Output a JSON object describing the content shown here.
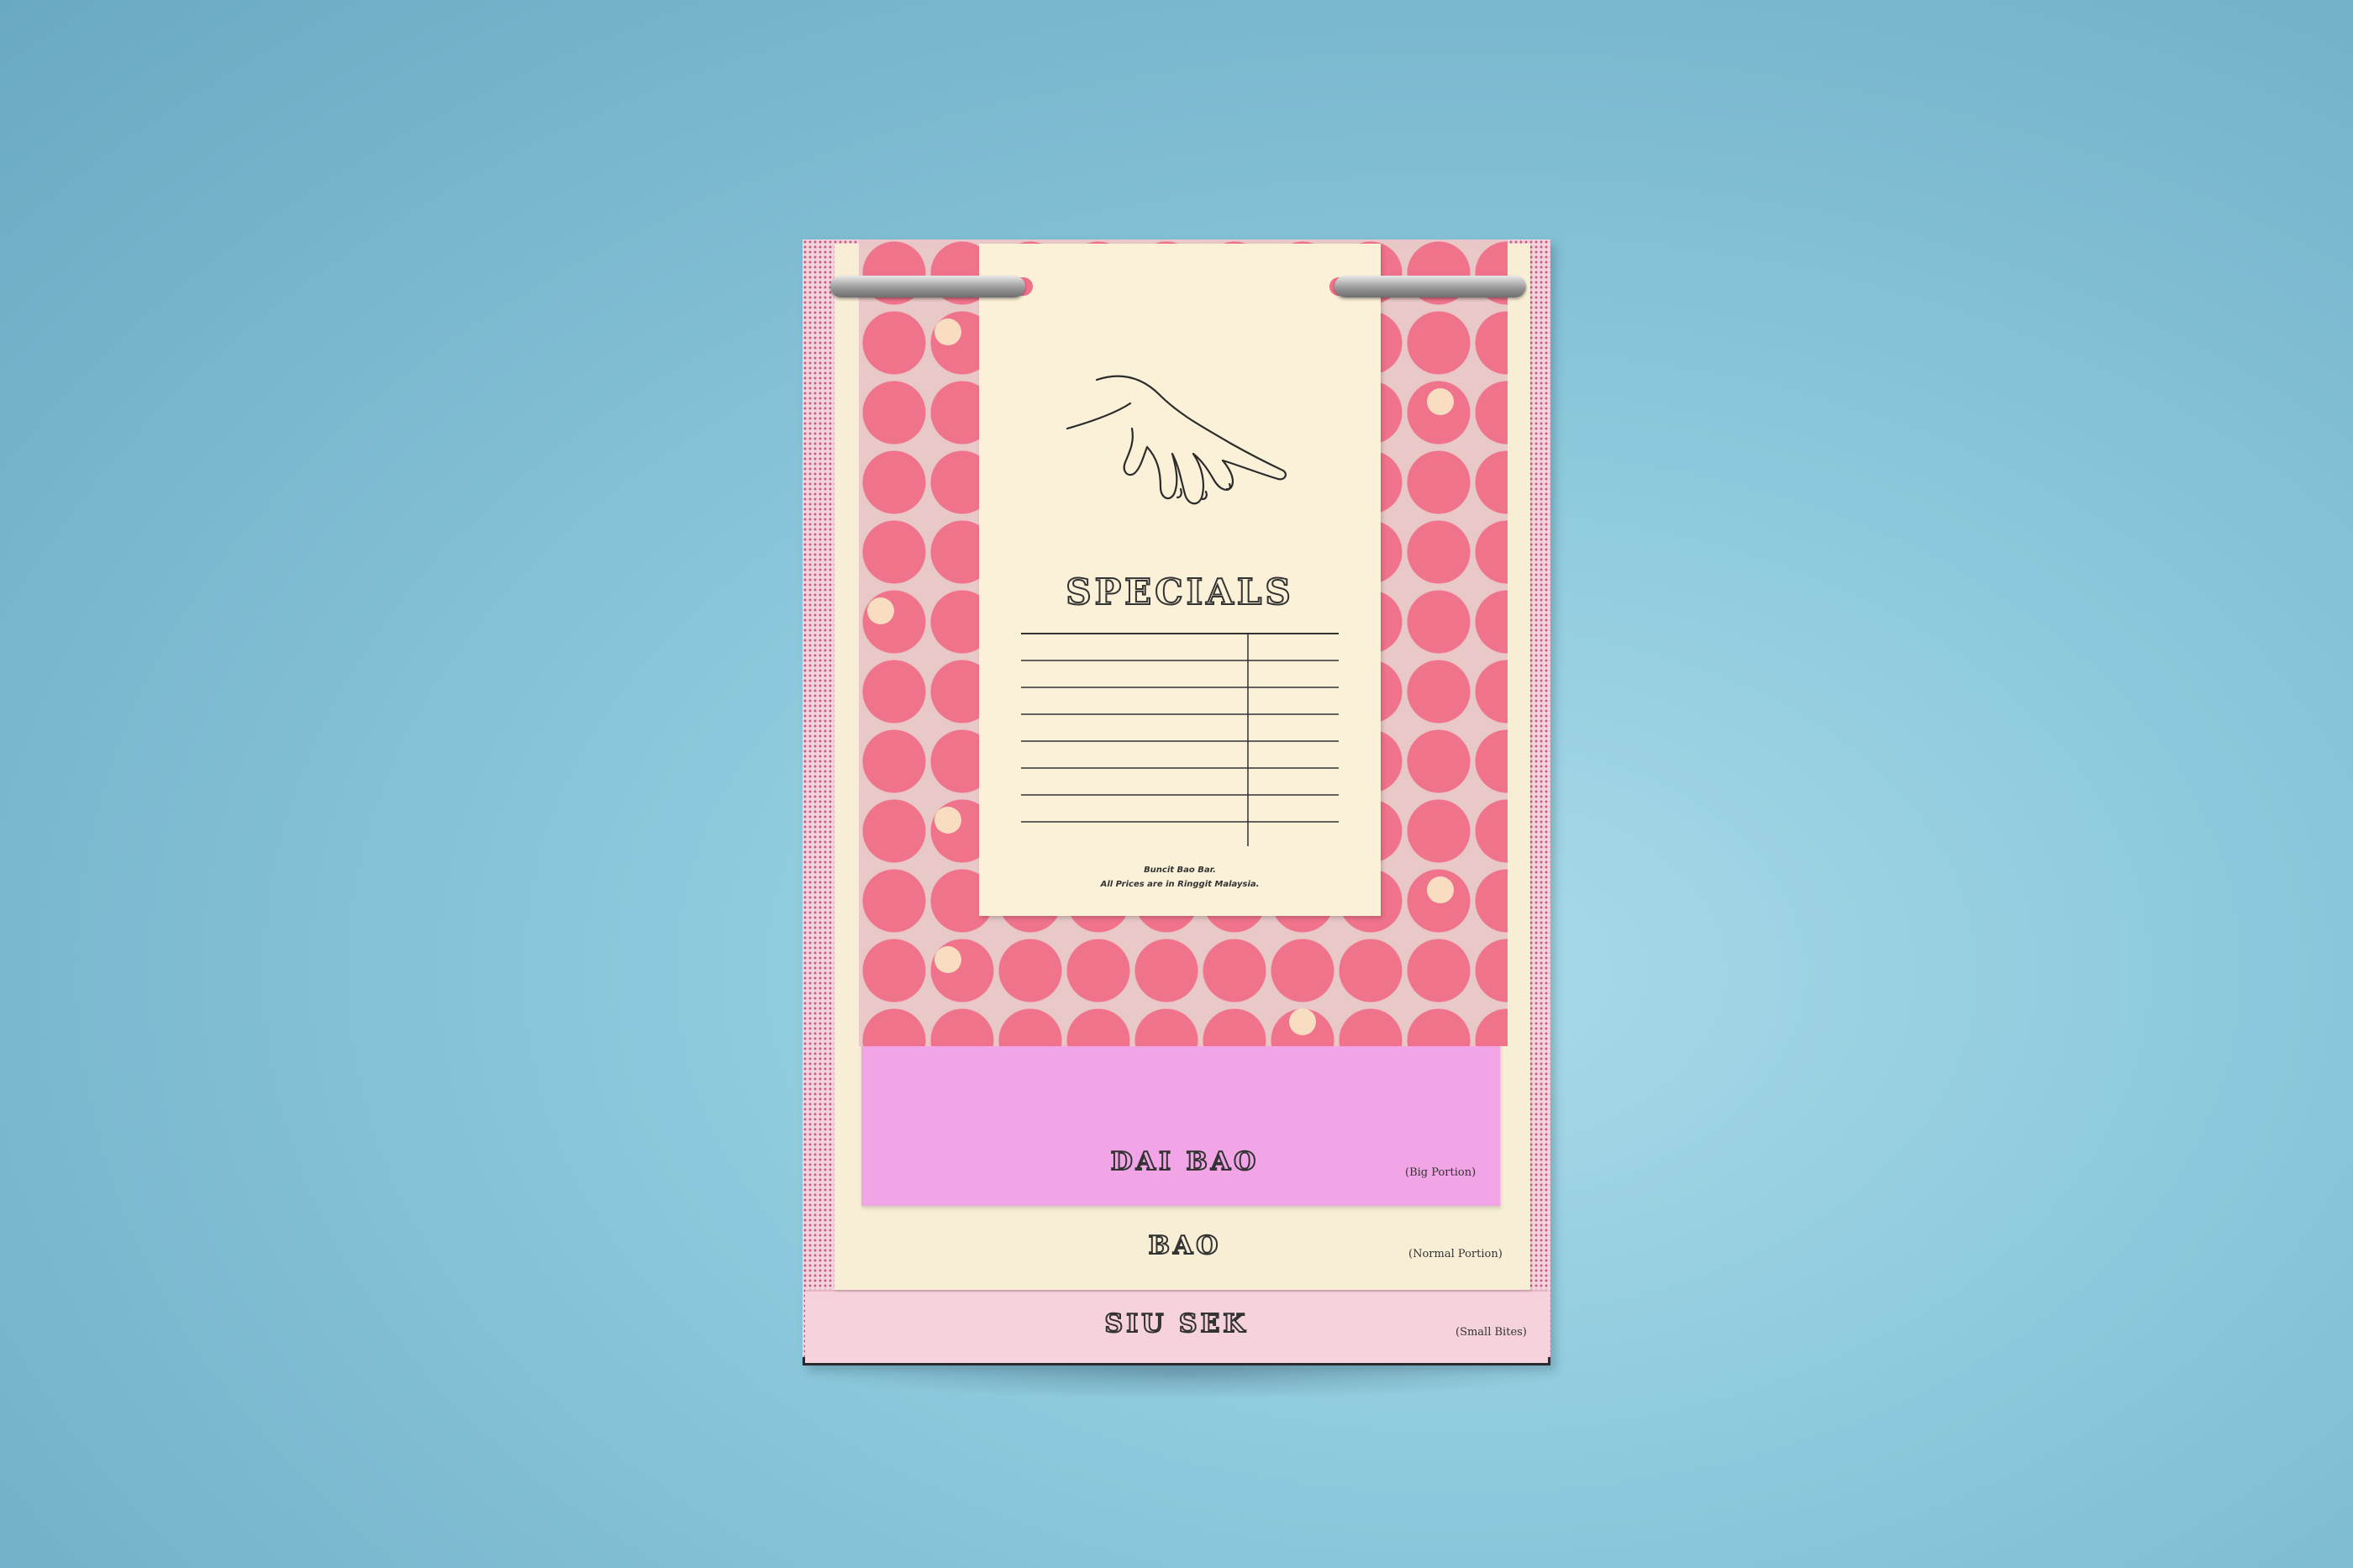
{
  "scene": {
    "background_color": "#8fcadd",
    "pattern_pink": "#f0708a",
    "purple_sheet": "#f1a4e6",
    "cream_sheet": "#f8eed6",
    "pink_sheet": "#f6d3dc"
  },
  "specials_card": {
    "illustration": "hand-line-drawing",
    "title": "SPECIALS",
    "table_rows": 8,
    "footer_line1": "Buncit Bao Bar.",
    "footer_line2": "All Prices are in Ringgit Malaysia."
  },
  "sections": [
    {
      "title": "DAI BAO",
      "portion": "(Big Portion)"
    },
    {
      "title": "BAO",
      "portion": "(Normal Portion)"
    },
    {
      "title": "SIU SEK",
      "portion": "(Small Bites)"
    }
  ]
}
